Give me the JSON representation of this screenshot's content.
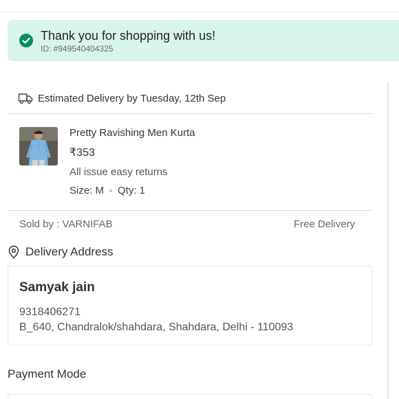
{
  "banner": {
    "title": "Thank you for shopping with us!",
    "order_id": "ID: #949540404325",
    "color": "#d9f5ea",
    "icon": "check-circle-icon",
    "icon_color": "#038d63"
  },
  "delivery": {
    "icon": "truck-icon",
    "text": "Estimated Delivery by Tuesday, 12th Sep"
  },
  "product": {
    "image": "kurta-product-image",
    "name": "Pretty Ravishing Men Kurta",
    "price": "₹353",
    "returns": "All issue easy returns",
    "size": "Size: M",
    "qty": "Qty: 1"
  },
  "seller": {
    "sold_by": "Sold by : VARNIFAB",
    "shipping": "Free Delivery"
  },
  "address": {
    "heading": "Delivery Address",
    "icon": "location-pin-icon",
    "name": "Samyak jain",
    "phone": "9318406271",
    "line": "B_640, Chandralok/shahdara, Shahdara, Delhi - 110093"
  },
  "payment": {
    "heading": "Payment Mode"
  }
}
